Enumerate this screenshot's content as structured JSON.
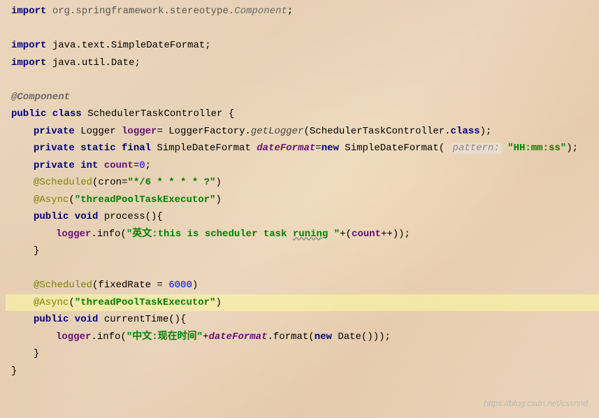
{
  "code": {
    "line1": {
      "kw": "import",
      "pkg": " org.springframework.stereotype.",
      "cls": "Component",
      "semi": ";"
    },
    "line3": {
      "kw": "import",
      "rest": " java.text.SimpleDateFormat;"
    },
    "line4": {
      "kw": "import",
      "rest": " java.util.Date;"
    },
    "line6": {
      "ann": "@Component"
    },
    "line7": {
      "kw1": "public class",
      "rest": " SchedulerTaskController {"
    },
    "line8": {
      "kw": "private",
      "type": " Logger ",
      "field": "logger",
      "eq": "= LoggerFactory.",
      "method": "getLogger",
      "args": "(SchedulerTaskController.",
      "kw2": "class",
      "close": ");"
    },
    "line9": {
      "kw": "private static final",
      "type": " SimpleDateFormat ",
      "field": "dateFormat",
      "eq": "=",
      "kw2": "new",
      "ctor": " SimpleDateFormat( ",
      "hint": "pattern:",
      "sp": " ",
      "str": "\"HH:mm:ss\"",
      "close": ");"
    },
    "line10": {
      "kw": "private int",
      "sp": " ",
      "field": "count",
      "eq": "=",
      "num": "0",
      "semi": ";"
    },
    "line11": {
      "ann": "@Scheduled",
      "open": "(cron=",
      "str": "\"*/6 * * * * ?\"",
      "close": ")"
    },
    "line12": {
      "ann": "@Async",
      "open": "(",
      "str": "\"threadPoolTaskExecutor\"",
      "close": ")"
    },
    "line13": {
      "kw": "public void",
      "rest": " process(){"
    },
    "line14": {
      "field": "logger",
      "call": ".info(",
      "str1": "\"英文:this is scheduler task ",
      "str2": "runing",
      "str3": " \"",
      "plus": "+(",
      "field2": "count",
      "inc": "++));"
    },
    "line15": {
      "brace": "}"
    },
    "line17": {
      "ann": "@Scheduled",
      "open": "(fixedRate = ",
      "num": "6000",
      "close": ")"
    },
    "line18": {
      "ann": "@Async",
      "open": "(",
      "str": "\"threadPoolTaskExecutor\"",
      "close": ")"
    },
    "line19": {
      "kw": "public void",
      "rest": " currentTime(){"
    },
    "line20": {
      "field": "logger",
      "call": ".info(",
      "str": "\"中文:现在时间\"",
      "plus": "+",
      "field2": "dateFormat",
      "fmt": ".format(",
      "kw2": "new",
      "date": " Date()));"
    },
    "line21": {
      "brace": "}"
    },
    "line22": {
      "brace": "}"
    }
  },
  "watermark": "https://blog.csdn.net/cssnnd"
}
